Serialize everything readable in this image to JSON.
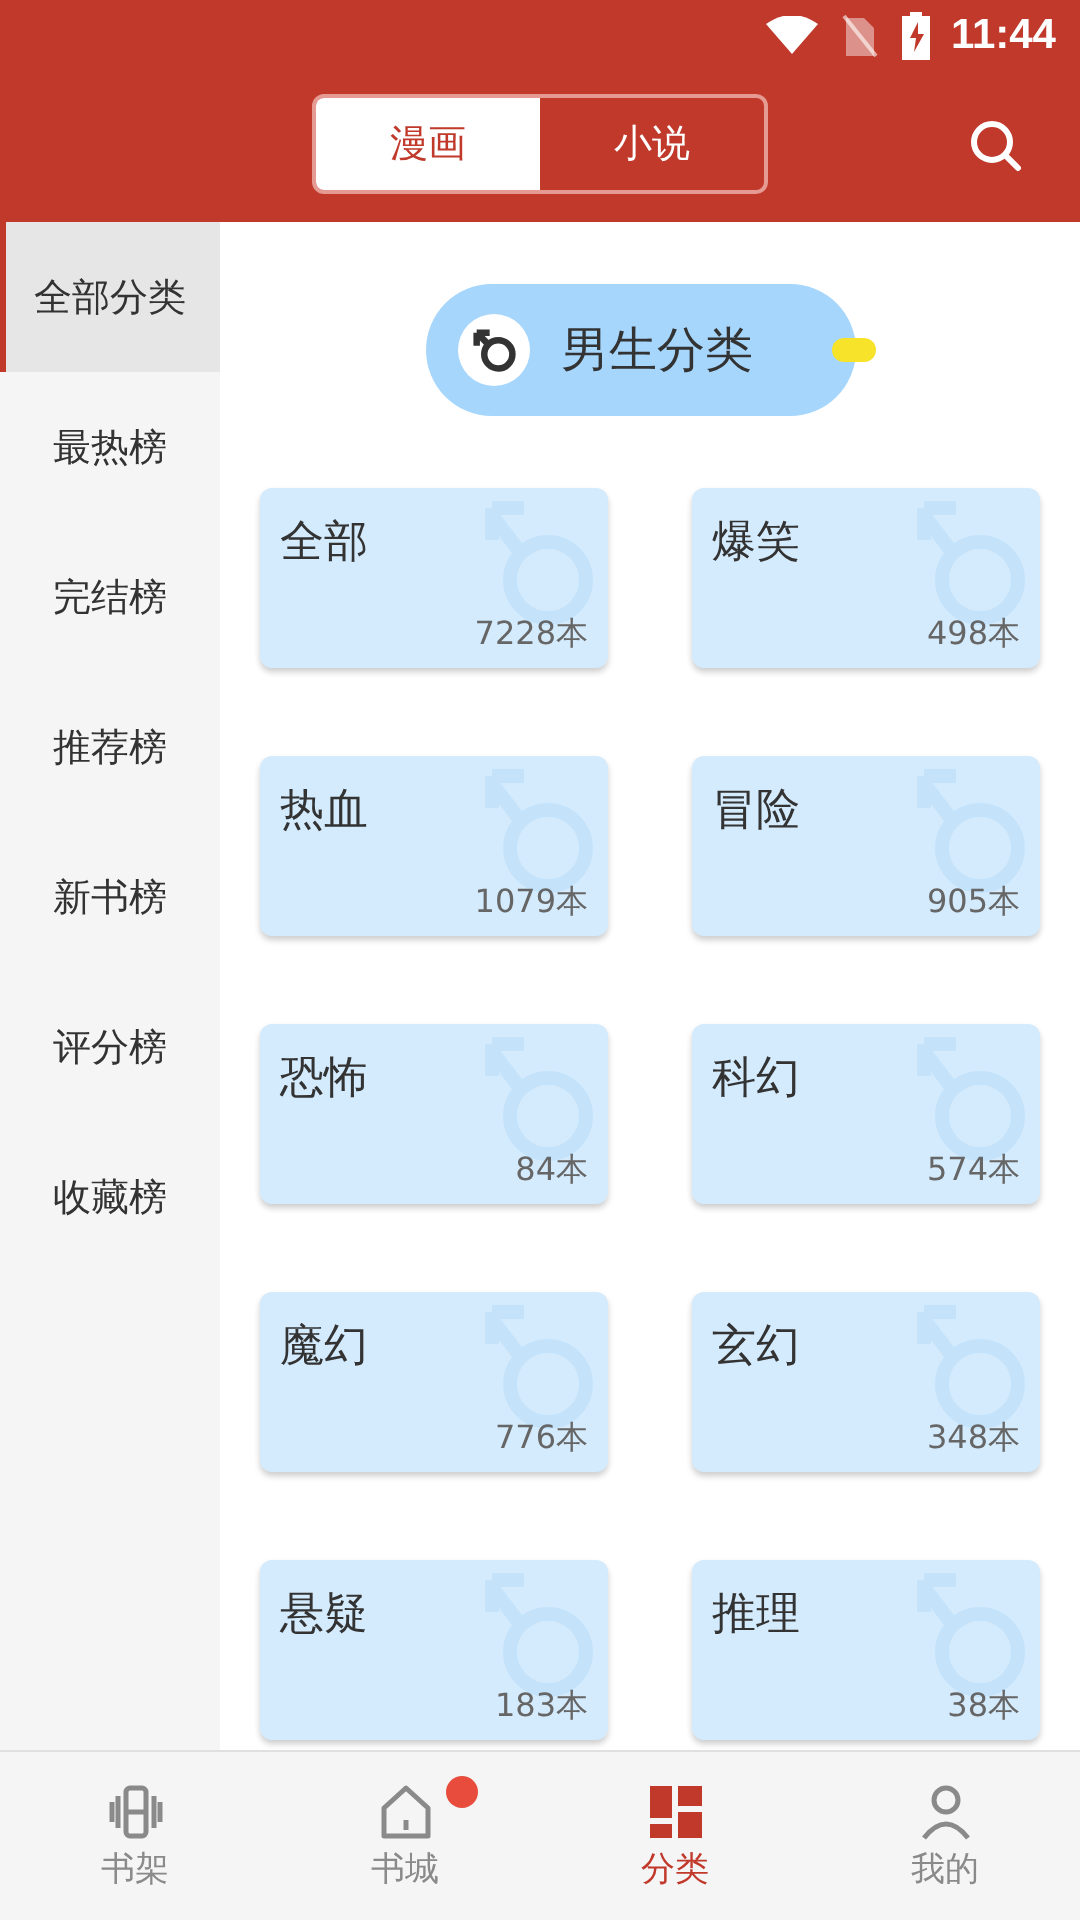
{
  "status_bar": {
    "time": "11:44"
  },
  "header": {
    "tabs": [
      {
        "label": "漫画",
        "selected": true
      },
      {
        "label": "小说",
        "selected": false
      }
    ]
  },
  "sidebar": {
    "items": [
      {
        "label": "全部分类",
        "selected": true
      },
      {
        "label": "最热榜",
        "selected": false
      },
      {
        "label": "完结榜",
        "selected": false
      },
      {
        "label": "推荐榜",
        "selected": false
      },
      {
        "label": "新书榜",
        "selected": false
      },
      {
        "label": "评分榜",
        "selected": false
      },
      {
        "label": "收藏榜",
        "selected": false
      }
    ]
  },
  "section": {
    "title": "男生分类"
  },
  "categories": [
    {
      "name": "全部",
      "count": "7228本"
    },
    {
      "name": "爆笑",
      "count": "498本"
    },
    {
      "name": "热血",
      "count": "1079本"
    },
    {
      "name": "冒险",
      "count": "905本"
    },
    {
      "name": "恐怖",
      "count": "84本"
    },
    {
      "name": "科幻",
      "count": "574本"
    },
    {
      "name": "魔幻",
      "count": "776本"
    },
    {
      "name": "玄幻",
      "count": "348本"
    },
    {
      "name": "悬疑",
      "count": "183本"
    },
    {
      "name": "推理",
      "count": "38本"
    }
  ],
  "bottom_nav": [
    {
      "label": "书架",
      "kind": "shelf",
      "selected": false,
      "dot": false
    },
    {
      "label": "书城",
      "kind": "home",
      "selected": false,
      "dot": true
    },
    {
      "label": "分类",
      "kind": "grid",
      "selected": true,
      "dot": false
    },
    {
      "label": "我的",
      "kind": "person",
      "selected": false,
      "dot": false
    }
  ]
}
